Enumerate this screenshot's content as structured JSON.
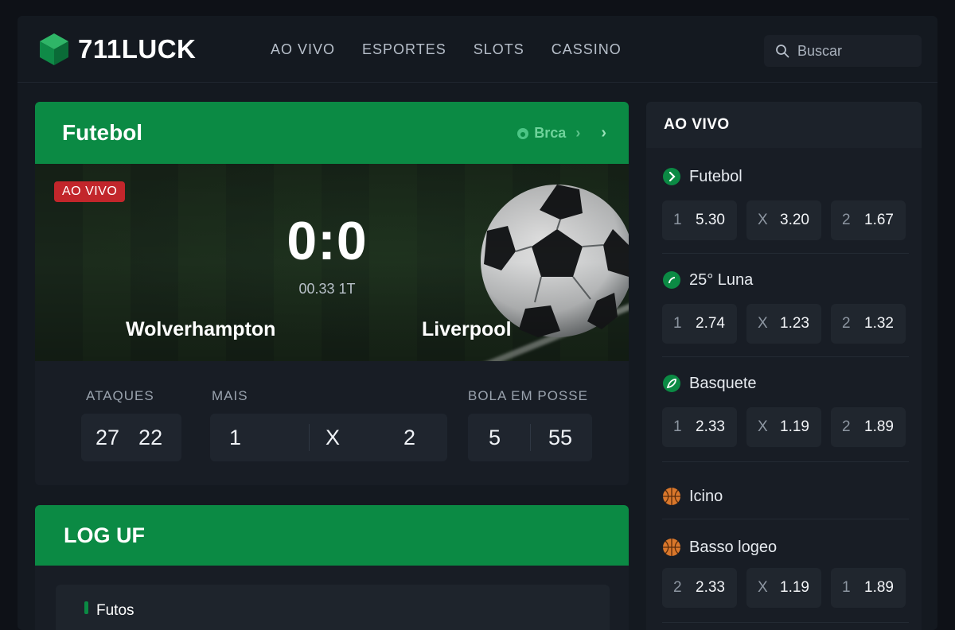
{
  "header": {
    "brand": "711LUCK",
    "nav": [
      "AO VIVO",
      "ESPORTES",
      "SLOTS",
      "CASSINO"
    ],
    "search_placeholder": "Buscar"
  },
  "match": {
    "section_title": "Futebol",
    "meta_label": "Brca",
    "live_badge": "AO VIVO",
    "score": "0:0",
    "clock": "00.33 1T",
    "home_team": "Wolverhampton",
    "away_team": "Liverpool",
    "stats": {
      "attacks_label": "ATAQUES",
      "attacks_home": "27",
      "attacks_away": "22",
      "more_label": "MAIS",
      "more_home": "1",
      "more_mid": "X",
      "more_away": "2",
      "possession_label": "BOLA EM POSSE",
      "possession_home": "5",
      "possession_away": "55"
    }
  },
  "log": {
    "title": "LOG UF",
    "item": "Futos"
  },
  "sidebar": {
    "title": "AO VIVO",
    "events": [
      {
        "name": "Futebol",
        "icon": "arrow-circle-icon",
        "odds": [
          {
            "k": "1",
            "v": "5.30"
          },
          {
            "k": "X",
            "v": "3.20"
          },
          {
            "k": "2",
            "v": "1.67"
          }
        ]
      },
      {
        "name": "25° Luna",
        "icon": "phone-circle-icon",
        "odds": [
          {
            "k": "1",
            "v": "2.74"
          },
          {
            "k": "X",
            "v": "1.23"
          },
          {
            "k": "2",
            "v": "1.32"
          }
        ]
      },
      {
        "name": "Basquete",
        "icon": "leaf-circle-icon",
        "odds": [
          {
            "k": "1",
            "v": "2.33"
          },
          {
            "k": "X",
            "v": "1.19"
          },
          {
            "k": "2",
            "v": "1.89"
          }
        ]
      },
      {
        "name": "Icino",
        "icon": "basketball-icon"
      },
      {
        "name": "Basso logeo",
        "icon": "basketball-icon",
        "odds": [
          {
            "k": "2",
            "v": "2.33"
          },
          {
            "k": "X",
            "v": "1.19"
          },
          {
            "k": "1",
            "v": "1.89"
          }
        ]
      }
    ]
  },
  "colors": {
    "brand_green": "#0b8a44",
    "live_red": "#c2262b",
    "background": "#0e1117",
    "panel": "#181d25"
  }
}
